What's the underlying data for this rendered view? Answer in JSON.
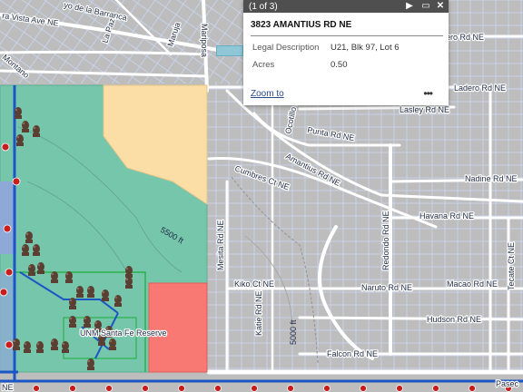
{
  "popup": {
    "count": "(1 of 3)",
    "title": "3823 AMANTIUS RD NE",
    "fields": [
      {
        "label": "Legal Description",
        "value": "U21, Blk 97, Lot 6"
      },
      {
        "label": "Acres",
        "value": "0.50"
      }
    ],
    "zoom_link": "Zoom to",
    "more": "•••",
    "play_icon": "play-icon",
    "maximize_icon": "maximize-icon",
    "close_icon": "close-icon"
  },
  "map": {
    "street_labels": [
      "ra Vista Ave NE",
      "yo de la Barranca",
      "Mariposa",
      "Maruja",
      "La Paz",
      "Montano",
      "Estero Rd NE",
      "Ladero Rd NE",
      "Lasley Rd NE",
      "Punta Rd NE",
      "Ocotillo Dr NE",
      "Amantius Rd NE",
      "Cumbres Ct NE",
      "Nadine Rd NE",
      "Havana Rd NE",
      "Redondo Rd NE",
      "Mesita Rd NE",
      "Macao Rd NE",
      "Kiko Ct NE",
      "Katie Rd NE",
      "Naruto Rd NE",
      "Hudson Rd NE",
      "Falcon Rd NE",
      "Tecate Ct NE",
      "Pasec",
      "5500 ft",
      "5000 ft",
      "UNM Santa Fe Reserve",
      "NE"
    ],
    "colors": {
      "background": "#bdbdbd",
      "park": "#76c6ab",
      "yellow_parcel": "#fbdda6",
      "red_parcel": "#f87873",
      "blue_parcel": "#8ea8d8",
      "parcel_lines": "#c9d6f3",
      "streets": "#ffffff",
      "boundary_green": "#2bb24c",
      "boundary_blue": "#1b56c4",
      "markers": "#c81e1e"
    }
  }
}
